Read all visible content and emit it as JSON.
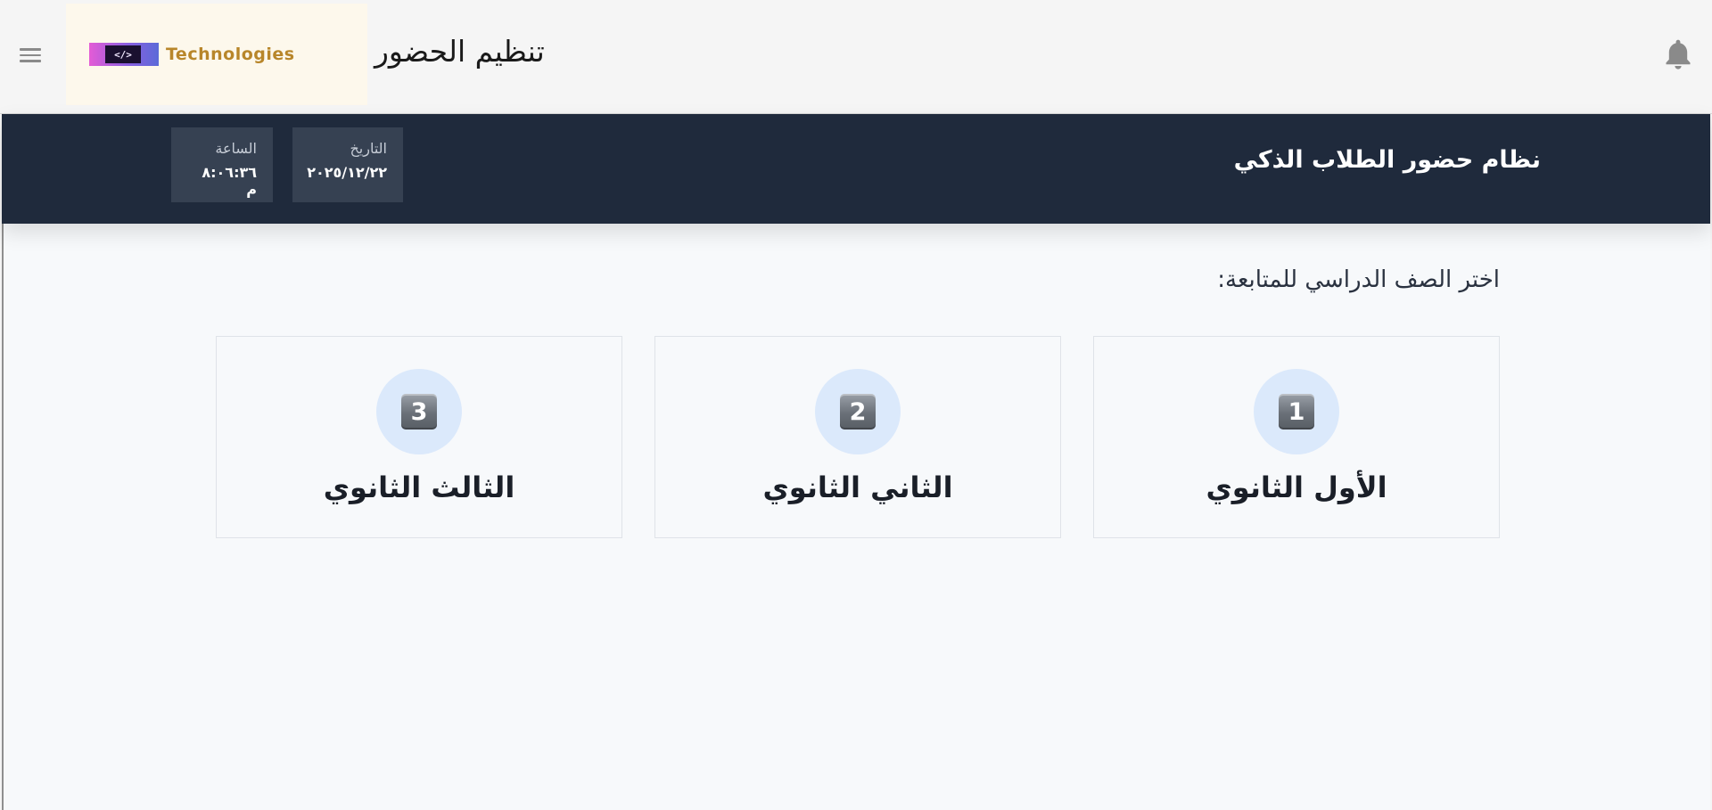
{
  "appbar": {
    "title": "تنظيم الحضور",
    "logo_text": "Technologies",
    "logo_mark_text": "</>",
    "menu_icon": "hamburger-menu-icon",
    "notification_icon": "bell-icon"
  },
  "header": {
    "title": "نظام حضور الطلاب الذكي",
    "date_label": "التاريخ",
    "date_value": "٢٠٢٥/١٢/٢٢",
    "time_label": "الساعة",
    "time_value": "٨:٠٦:٣٦ م"
  },
  "main": {
    "section_title": "اختر الصف الدراسي للمتابعة:",
    "grades": [
      {
        "badge": "1",
        "label": "الأول الثانوي"
      },
      {
        "badge": "2",
        "label": "الثاني الثانوي"
      },
      {
        "badge": "3",
        "label": "الثالث الثانوي"
      }
    ]
  },
  "colors": {
    "header_bg": "#1f2a3c",
    "info_card_bg": "#364152",
    "badge_circle_bg": "#dbe9fb",
    "logo_text": "#b8862a"
  }
}
